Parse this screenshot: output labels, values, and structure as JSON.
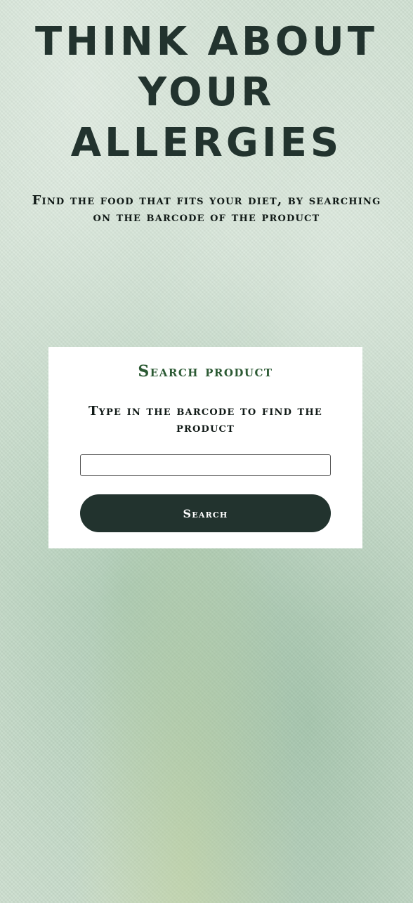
{
  "hero": {
    "title": "Think about your allergies",
    "subtitle": "Find the food that fits your diet, by searching on the barcode of the product"
  },
  "search_card": {
    "title": "Search product",
    "instruction": "Type in the barcode to find the product",
    "input": {
      "value": "",
      "placeholder": ""
    },
    "button_label": "Search"
  },
  "colors": {
    "title_dark": "#22332e",
    "card_title_green": "#2c5a34",
    "button_bg": "#22332e",
    "card_bg": "#ffffff"
  }
}
